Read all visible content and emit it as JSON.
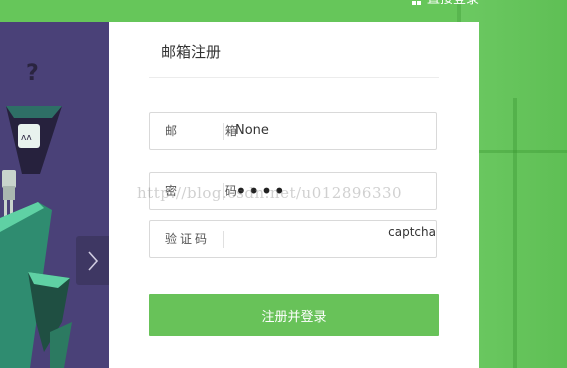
{
  "top_link": {
    "label": "直接登录"
  },
  "form": {
    "title": "邮箱注册",
    "email": {
      "label": "邮 箱",
      "value": "None"
    },
    "password": {
      "label": "密 码",
      "value": "••••"
    },
    "captcha": {
      "label": "验证码",
      "value": "",
      "image_text": "captcha"
    },
    "submit_label": "注册并登录"
  },
  "watermark": "http://blog.csdn.net/u012896330",
  "colors": {
    "accent_green": "#68c259",
    "background_green": "#66c65a",
    "illustration_purple": "#4a4178"
  },
  "icons": {
    "top_link_icon": "grid-icon",
    "slider_next": "chevron-right-icon"
  }
}
